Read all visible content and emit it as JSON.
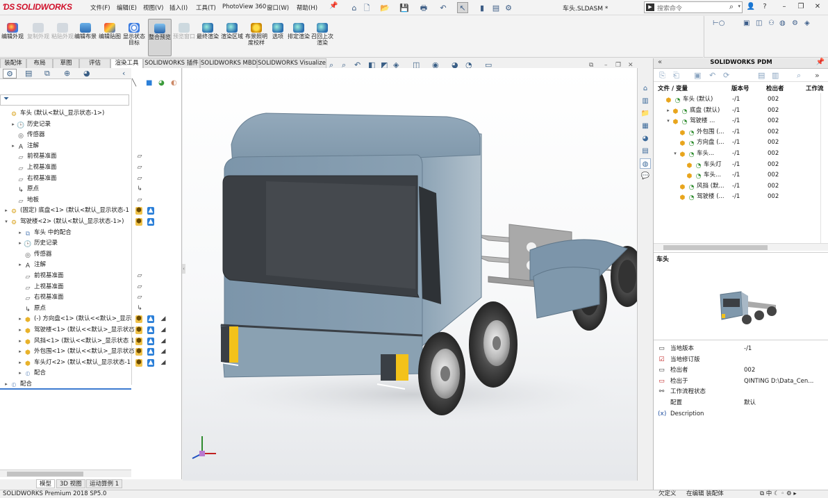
{
  "app": {
    "brand": "SOLIDWORKS",
    "document_title": "车头.SLDASM *",
    "status": "SOLIDWORKS Premium 2018 SP5.0"
  },
  "menu": [
    "文件(F)",
    "编辑(E)",
    "视图(V)",
    "插入(I)",
    "工具(T)",
    "PhotoView 360",
    "窗口(W)",
    "帮助(H)"
  ],
  "search": {
    "placeholder": "搜索命令"
  },
  "toolbar": [
    {
      "label": "编辑外观",
      "enabled": true
    },
    {
      "label": "复制外观",
      "enabled": false
    },
    {
      "label": "粘贴外观",
      "enabled": false
    },
    {
      "label": "编辑布景",
      "enabled": true
    },
    {
      "label": "编辑贴图",
      "enabled": true
    },
    {
      "label": "显示状态目标",
      "enabled": true
    },
    {
      "label": "整合预览",
      "enabled": true,
      "active": true
    },
    {
      "label": "预览窗口",
      "enabled": false
    },
    {
      "label": "最终渲染",
      "enabled": true
    },
    {
      "label": "渲染区域",
      "enabled": true
    },
    {
      "label": "布景照明度校样",
      "enabled": true
    },
    {
      "label": "选项",
      "enabled": true
    },
    {
      "label": "排定渲染",
      "enabled": true
    },
    {
      "label": "召回上次渲染",
      "enabled": true
    }
  ],
  "tabs": [
    "装配体",
    "布局",
    "草图",
    "评估",
    "渲染工具",
    "SOLIDWORKS 插件",
    "SOLIDWORKS MBD",
    "SOLIDWORKS Visualize"
  ],
  "active_tab": "渲染工具",
  "feature_tree": [
    {
      "label": "车头 (默认<默认_显示状态-1>)",
      "depth": 0,
      "icon": "assembly-icon",
      "expander": ""
    },
    {
      "label": "历史记录",
      "depth": 1,
      "icon": "history-icon",
      "expander": "▸"
    },
    {
      "label": "传感器",
      "depth": 1,
      "icon": "sensor-icon",
      "expander": ""
    },
    {
      "label": "注解",
      "depth": 1,
      "icon": "annotation-icon",
      "expander": "▸"
    },
    {
      "label": "前视基准面",
      "depth": 1,
      "icon": "plane-icon",
      "expander": ""
    },
    {
      "label": "上视基准面",
      "depth": 1,
      "icon": "plane-icon",
      "expander": ""
    },
    {
      "label": "右视基准面",
      "depth": 1,
      "icon": "plane-icon",
      "expander": ""
    },
    {
      "label": "原点",
      "depth": 1,
      "icon": "origin-icon",
      "expander": ""
    },
    {
      "label": "地板",
      "depth": 1,
      "icon": "plane-icon",
      "expander": ""
    },
    {
      "label": "(固定) 底盘<1> (默认<默认_显示状态-1",
      "depth": 0,
      "icon": "assembly-icon",
      "expander": "▸"
    },
    {
      "label": "驾驶楼<2> (默认<默认_显示状态-1>)",
      "depth": 0,
      "icon": "assembly-icon",
      "expander": "▾"
    },
    {
      "label": "车头 中的配合",
      "depth": 2,
      "icon": "mate-folder-icon",
      "expander": "▸"
    },
    {
      "label": "历史记录",
      "depth": 2,
      "icon": "history-icon",
      "expander": "▸"
    },
    {
      "label": "传感器",
      "depth": 2,
      "icon": "sensor-icon",
      "expander": ""
    },
    {
      "label": "注解",
      "depth": 2,
      "icon": "annotation-icon",
      "expander": "▸"
    },
    {
      "label": "前视基准面",
      "depth": 2,
      "icon": "plane-icon",
      "expander": ""
    },
    {
      "label": "上视基准面",
      "depth": 2,
      "icon": "plane-icon",
      "expander": ""
    },
    {
      "label": "右视基准面",
      "depth": 2,
      "icon": "plane-icon",
      "expander": ""
    },
    {
      "label": "原点",
      "depth": 2,
      "icon": "origin-icon",
      "expander": ""
    },
    {
      "label": "(-) 方向盘<1> (默认<<默认>_显示",
      "depth": 2,
      "icon": "part-icon",
      "expander": "▸"
    },
    {
      "label": "驾驶楼<1> (默认<<默认>_显示状态",
      "depth": 2,
      "icon": "part-icon",
      "expander": "▸"
    },
    {
      "label": "风挡<1> (默认<<默认>_显示状态 1",
      "depth": 2,
      "icon": "part-icon",
      "expander": "▸"
    },
    {
      "label": "外包围<1> (默认<<默认>_显示状态",
      "depth": 2,
      "icon": "part-icon",
      "expander": "▸"
    },
    {
      "label": "车头灯<2> (默认<默认_显示状态-1",
      "depth": 2,
      "icon": "part-icon",
      "expander": "▸"
    },
    {
      "label": "配合",
      "depth": 2,
      "icon": "mates-icon",
      "expander": "▸"
    },
    {
      "label": "配合",
      "depth": 0,
      "icon": "mates-icon",
      "expander": "▸"
    }
  ],
  "bottom_tabs": [
    "模型",
    "3D 视图",
    "运动算例 1"
  ],
  "pdm": {
    "title": "SOLIDWORKS PDM",
    "columns": [
      "文件 / 变量",
      "版本号",
      "检出者",
      "工作流"
    ],
    "rows": [
      {
        "name": "车头 (默认)",
        "version": "-/1",
        "checked_by": "002",
        "depth": 0,
        "expander": ""
      },
      {
        "name": "底盘 (默认)",
        "version": "-/1",
        "checked_by": "002",
        "depth": 1,
        "expander": "▸"
      },
      {
        "name": "驾驶楼 ...",
        "version": "-/1",
        "checked_by": "002",
        "depth": 1,
        "expander": "▾"
      },
      {
        "name": "外包围 (...",
        "version": "-/1",
        "checked_by": "002",
        "depth": 2,
        "expander": ""
      },
      {
        "name": "方向盘 (...",
        "version": "-/1",
        "checked_by": "002",
        "depth": 2,
        "expander": ""
      },
      {
        "name": "车头...",
        "version": "-/1",
        "checked_by": "002",
        "depth": 2,
        "expander": "▾"
      },
      {
        "name": "车头灯",
        "version": "-/1",
        "checked_by": "002",
        "depth": 3,
        "expander": ""
      },
      {
        "name": "车头...",
        "version": "-/1",
        "checked_by": "002",
        "depth": 3,
        "expander": ""
      },
      {
        "name": "风挡 (默...",
        "version": "-/1",
        "checked_by": "002",
        "depth": 2,
        "expander": ""
      },
      {
        "name": "驾驶楼 (...",
        "version": "-/1",
        "checked_by": "002",
        "depth": 2,
        "expander": ""
      }
    ],
    "preview_label": "车头",
    "properties": [
      {
        "key": "当地版本",
        "value": "-/1",
        "icon": "version-icon"
      },
      {
        "key": "当地修订版",
        "value": "",
        "icon": "revision-icon"
      },
      {
        "key": "检出者",
        "value": "002",
        "icon": "user-icon"
      },
      {
        "key": "检出于",
        "value": "QINTING  D:\\Data_Cen...",
        "icon": "location-icon"
      },
      {
        "key": "工作流程状态",
        "value": "",
        "icon": "workflow-icon"
      },
      {
        "key": "配置",
        "value": "默认",
        "icon": ""
      },
      {
        "key": "Description",
        "value": "",
        "icon": "variable-icon"
      }
    ]
  },
  "statusbar": {
    "left": "SOLIDWORKS Premium 2018 SP5.0",
    "right1": "欠定义",
    "right2": "在编辑 装配体"
  },
  "colors": {
    "brand_red": "#d0102a",
    "truck_body": "#7f98ac",
    "selection_blue": "#3c7ad0"
  }
}
